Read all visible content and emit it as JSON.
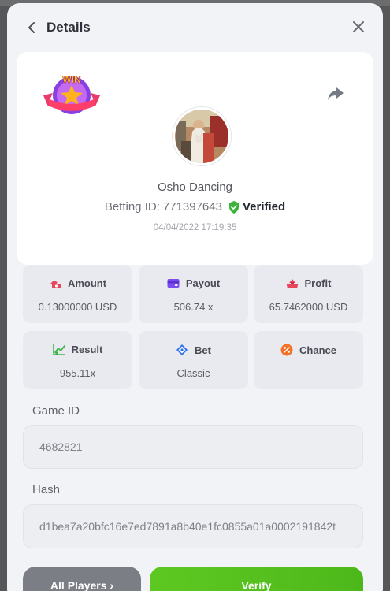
{
  "header": {
    "title": "Details"
  },
  "player": {
    "name": "Osho Dancing",
    "betting_id_label": "Betting ID:",
    "betting_id": "771397643",
    "verified_label": "Verified",
    "timestamp": "04/04/2022 17:19:35",
    "badge_text": "WIN"
  },
  "stats": {
    "amount": {
      "label": "Amount",
      "value": "0.13000000 USD"
    },
    "payout": {
      "label": "Payout",
      "value": "506.74 x"
    },
    "profit": {
      "label": "Profit",
      "value": "65.7462000 USD"
    },
    "result": {
      "label": "Result",
      "value": "955.11x"
    },
    "bet": {
      "label": "Bet",
      "value": "Classic"
    },
    "chance": {
      "label": "Chance",
      "value": "-"
    }
  },
  "game": {
    "game_id_label": "Game ID",
    "game_id": "4682821",
    "hash_label": "Hash",
    "hash": "d1bea7a20bfc16e7ed7891a8b40e1fc0855a01a0002191842t"
  },
  "buttons": {
    "all_players": "All Players ›",
    "verify": "Verify"
  },
  "colors": {
    "verify_green": "#5ec822",
    "verified_shield": "#3cb43c",
    "amount_icon": "#e8465d",
    "payout_icon": "#7b4cf0",
    "profit_icon": "#e8465d",
    "result_icon": "#3cb44a",
    "bet_icon": "#2d6ff0",
    "chance_icon": "#f27228"
  }
}
